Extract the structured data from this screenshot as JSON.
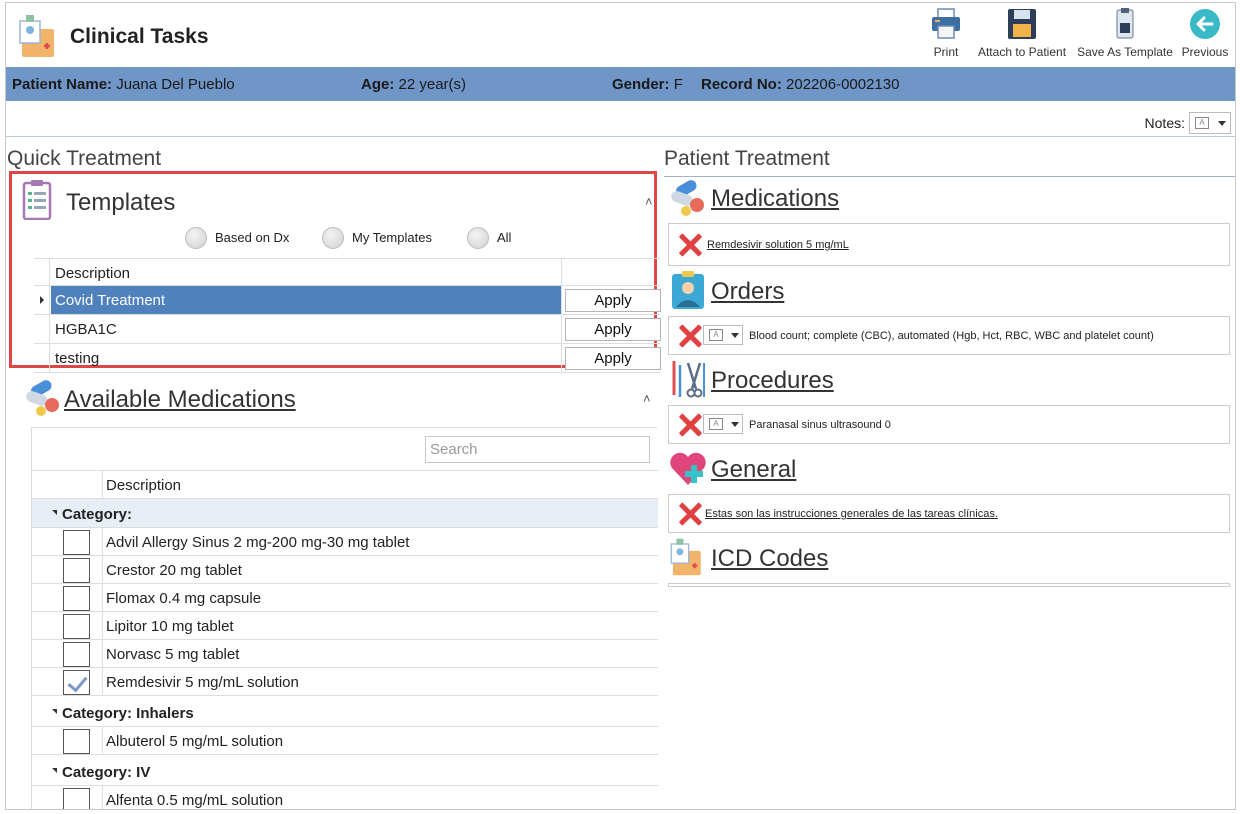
{
  "app": {
    "title": "Clinical Tasks"
  },
  "toolbar": {
    "print": "Print",
    "attach": "Attach to Patient",
    "save_template": "Save As Template",
    "previous": "Previous"
  },
  "patient": {
    "name_label": "Patient Name:",
    "name": "Juana Del Pueblo",
    "age_label": "Age:",
    "age": "22 year(s)",
    "gender_label": "Gender:",
    "gender": "F",
    "record_label": "Record No:",
    "record": "202206-0002130"
  },
  "notes": {
    "label": "Notes:"
  },
  "quick_treatment": {
    "title": "Quick Treatment",
    "templates": {
      "title": "Templates",
      "filters": [
        "Based on Dx",
        "My Templates",
        "All"
      ],
      "column": "Description",
      "rows": [
        {
          "description": "Covid Treatment",
          "action": "Apply",
          "selected": true
        },
        {
          "description": "HGBA1C",
          "action": "Apply",
          "selected": false
        },
        {
          "description": "testing",
          "action": "Apply",
          "selected": false
        }
      ]
    },
    "available_medications": {
      "title": "Available Medications",
      "search_placeholder": "Search",
      "column": "Description",
      "categories": [
        {
          "label": "Category:",
          "items": [
            {
              "name": "Advil Allergy Sinus 2 mg-200 mg-30 mg tablet",
              "checked": false
            },
            {
              "name": "Crestor 20 mg tablet",
              "checked": false
            },
            {
              "name": "Flomax 0.4 mg capsule",
              "checked": false
            },
            {
              "name": "Lipitor 10 mg tablet",
              "checked": false
            },
            {
              "name": "Norvasc 5 mg tablet",
              "checked": false
            },
            {
              "name": "Remdesivir 5 mg/mL solution",
              "checked": true
            }
          ]
        },
        {
          "label": "Category: Inhalers",
          "items": [
            {
              "name": "Albuterol 5 mg/mL solution",
              "checked": false
            }
          ]
        },
        {
          "label": "Category: IV",
          "items": [
            {
              "name": "Alfenta 0.5 mg/mL solution",
              "checked": false
            }
          ]
        }
      ]
    }
  },
  "patient_treatment": {
    "title": "Patient Treatment",
    "medications": {
      "title": "Medications",
      "item": "Remdesivir solution 5 mg/mL"
    },
    "orders": {
      "title": "Orders",
      "item": "Blood count; complete (CBC), automated (Hgb, Hct, RBC, WBC and platelet count)"
    },
    "procedures": {
      "title": "Procedures",
      "item": "Paranasal sinus ultrasound 0"
    },
    "general": {
      "title": "General",
      "item": "Estas son las instrucciones generales de las tareas clínicas."
    },
    "icd": {
      "title": "ICD Codes"
    }
  },
  "colors": {
    "patient_bar": "#6f96c7",
    "selected_row": "#4f81bd",
    "highlight_border": "#e04545",
    "remove_x": "#e04040"
  }
}
